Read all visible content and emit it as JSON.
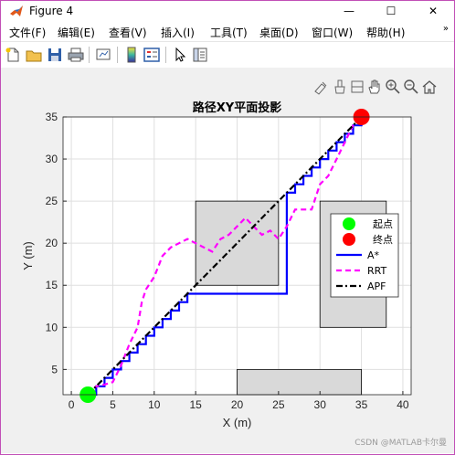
{
  "window": {
    "title": "Figure 4",
    "controls": {
      "minimize": "—",
      "maximize": "☐",
      "close": "✕"
    }
  },
  "menubar": {
    "items": [
      "文件(F)",
      "编辑(E)",
      "查看(V)",
      "插入(I)",
      "工具(T)",
      "桌面(D)",
      "窗口(W)",
      "帮助(H)"
    ],
    "overflow_arrow": "»"
  },
  "toolbar": {
    "buttons": [
      "new-figure-icon",
      "open-file-icon",
      "save-icon",
      "print-icon",
      "link-plot-icon",
      "colorbar-icon",
      "legend-icon",
      "pointer-icon",
      "property-inspector-icon"
    ]
  },
  "axes_toolbar": {
    "buttons": [
      "data-tips-icon",
      "brush-icon",
      "restore-view-icon",
      "pan-hand-icon",
      "zoom-in-icon",
      "zoom-out-icon",
      "home-icon"
    ]
  },
  "colors": {
    "background": "#f0f0f0",
    "axes_bg": "#ffffff",
    "obstacle_fill": "#d9d9d9",
    "astar": "#0000ff",
    "rrt": "#ff00ff",
    "apf": "#000000",
    "start": "#00ff00",
    "goal": "#ff0000"
  },
  "chart_data": {
    "type": "line",
    "title": "路径XY平面投影",
    "xlabel": "X (m)",
    "ylabel": "Y (m)",
    "xlim": [
      -1,
      41
    ],
    "ylim": [
      2,
      35
    ],
    "xticks": [
      0,
      5,
      10,
      15,
      20,
      25,
      30,
      35,
      40
    ],
    "yticks": [
      5,
      10,
      15,
      20,
      25,
      30,
      35
    ],
    "grid": true,
    "legend_placement": "right",
    "legend": [
      "起点",
      "终点",
      "A*",
      "RRT",
      "APF"
    ],
    "obstacles": [
      {
        "x": [
          15,
          25
        ],
        "y": [
          15,
          25
        ]
      },
      {
        "x": [
          30,
          38
        ],
        "y": [
          10,
          25
        ]
      },
      {
        "x": [
          20,
          35
        ],
        "y": [
          2,
          5
        ]
      }
    ],
    "start": {
      "x": 2,
      "y": 2
    },
    "goal": {
      "x": 35,
      "y": 35
    },
    "series": [
      {
        "name": "A*",
        "x": [
          2,
          3,
          3,
          4,
          4,
          5,
          5,
          6,
          6,
          7,
          7,
          8,
          8,
          9,
          9,
          10,
          10,
          11,
          11,
          12,
          12,
          13,
          13,
          14,
          14,
          15,
          15,
          26,
          26,
          27,
          27,
          28,
          28,
          29,
          29,
          30,
          30,
          31,
          31,
          32,
          32,
          33,
          33,
          34,
          34,
          35,
          35
        ],
        "y": [
          2,
          2,
          3,
          3,
          4,
          4,
          5,
          5,
          6,
          6,
          7,
          7,
          8,
          8,
          9,
          9,
          10,
          10,
          11,
          11,
          12,
          12,
          13,
          13,
          14,
          14,
          14,
          14,
          26,
          26,
          27,
          27,
          28,
          28,
          29,
          29,
          30,
          30,
          31,
          31,
          32,
          32,
          33,
          33,
          34,
          34,
          35
        ]
      },
      {
        "name": "RRT",
        "x": [
          2,
          3,
          4,
          5,
          5.5,
          6,
          7,
          8,
          8.5,
          9,
          10,
          11,
          12,
          13,
          14,
          15,
          16,
          17,
          18,
          19,
          20,
          21,
          22,
          23,
          24,
          25,
          26,
          27,
          28,
          29,
          30,
          31,
          32,
          33,
          34,
          35
        ],
        "y": [
          2,
          3,
          3.2,
          3.5,
          4.5,
          5.5,
          8,
          10,
          13,
          14.5,
          16,
          18.5,
          19.5,
          20,
          20.5,
          20,
          19.5,
          19,
          20.5,
          21,
          22,
          23,
          22,
          21,
          21.5,
          20.5,
          22,
          24,
          24,
          24,
          27,
          28,
          30,
          32,
          34,
          35
        ]
      },
      {
        "name": "APF",
        "x": [
          2,
          35
        ],
        "y": [
          2,
          35
        ]
      }
    ]
  },
  "watermark": "CSDN @MATLAB卡尔曼"
}
